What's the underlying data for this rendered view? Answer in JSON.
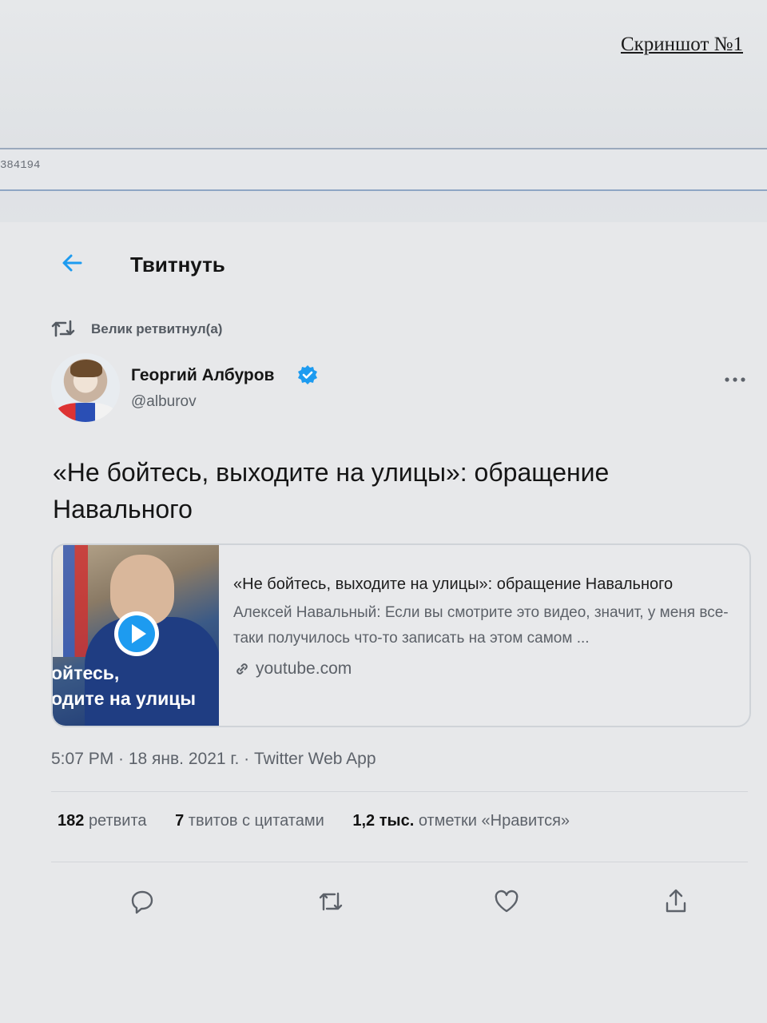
{
  "document": {
    "label": "Скриншот №1",
    "url_fragment": "384194"
  },
  "header": {
    "title": "Твитнуть",
    "back_icon": "arrow-left-icon"
  },
  "retweeted_by": {
    "text": "Велик ретвитнул(а)",
    "icon": "retweet-icon"
  },
  "author": {
    "name": "Георгий Албуров",
    "handle": "@alburov",
    "verified": true,
    "avatar_icon": "avatar-photo"
  },
  "tweet": {
    "text": "«Не бойтесь, выходите на улицы»: обращение Навального"
  },
  "link_card": {
    "thumbnail_caption_line1": "ойтесь,",
    "thumbnail_caption_line2": "одите на улицы",
    "title": "«Не бойтесь, выходите на улицы»: обращение Навального",
    "description": "Алексей Навальный: Если вы смотрите это видео, значит, у меня все-таки получилось что-то записать на этом самом ...",
    "domain": "youtube.com"
  },
  "meta": {
    "text": "5:07 PM · 18 янв. 2021 г. · Twitter Web App"
  },
  "stats": {
    "retweets_count": "182",
    "retweets_label": "ретвита",
    "quotes_count": "7",
    "quotes_label": "твитов с цитатами",
    "likes_count": "1,2 тыс.",
    "likes_label": "отметки «Нравится»"
  },
  "actions": [
    "reply-icon",
    "retweet-icon",
    "like-icon",
    "share-icon"
  ],
  "colors": {
    "accent": "#1d9bf0",
    "text_primary": "#151515",
    "text_secondary": "#5d626a"
  }
}
